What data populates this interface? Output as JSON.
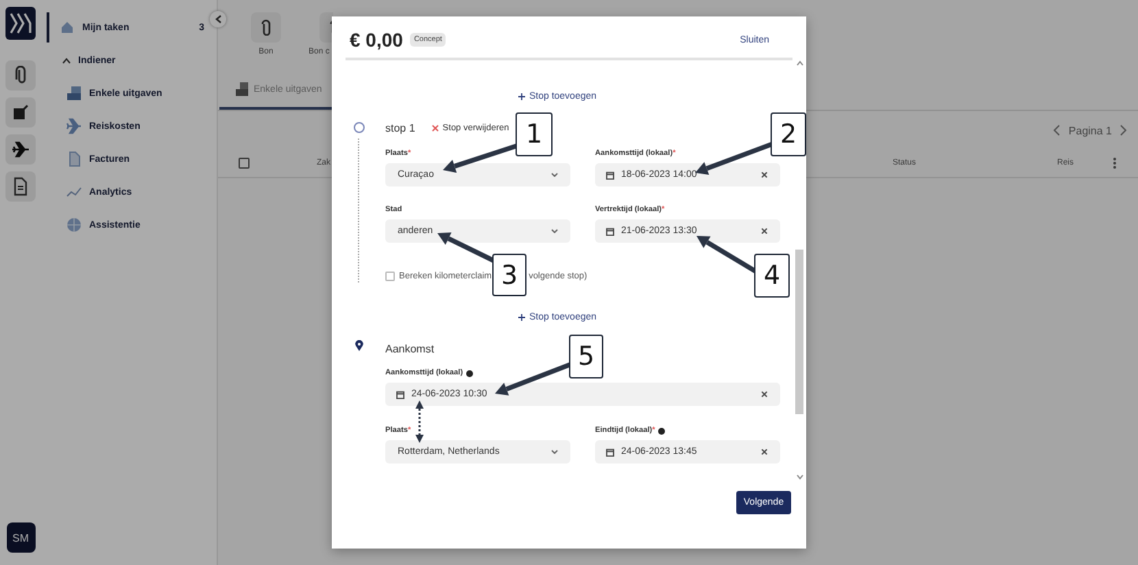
{
  "rail": {
    "items": [
      {
        "kind": "clip"
      },
      {
        "kind": "edit"
      },
      {
        "kind": "plane"
      },
      {
        "kind": "doc"
      }
    ],
    "avatar": "SM"
  },
  "sidebar": {
    "top_item": {
      "label": "Mijn taken",
      "count": "3"
    },
    "section": {
      "label": "Indiener",
      "expanded": true
    },
    "items": [
      {
        "label": "Enkele uitgaven",
        "kind": "expenses"
      },
      {
        "label": "Reiskosten",
        "kind": "travel"
      },
      {
        "label": "Facturen",
        "kind": "invoices"
      },
      {
        "label": "Analytics",
        "kind": "analytics"
      },
      {
        "label": "Assistentie",
        "kind": "assist"
      }
    ]
  },
  "toolbar": {
    "tiles": [
      {
        "label": "Bon"
      },
      {
        "label": "Bon c"
      }
    ]
  },
  "tabs": [
    {
      "label": "Enkele uitgaven",
      "selected": true
    }
  ],
  "pager": {
    "label": "Pagina 1"
  },
  "table": {
    "columns": [
      "Zak",
      "Status",
      "Reis"
    ],
    "select_all_checked": false
  },
  "modal": {
    "amount": "€ 0,00",
    "badge": "Concept",
    "close": "Sluiten",
    "add_stop": [
      "Stop toevoegen",
      "Stop toevoegen"
    ],
    "stops": [
      {
        "title": "stop 1",
        "remove": "Stop verwijderen",
        "fields": [
          {
            "label": "Plaats",
            "asterisk": "*",
            "kind": "select",
            "value": "Curaçao"
          },
          {
            "label": "Aankomsttijd (lokaal)",
            "asterisk": "*",
            "kind": "date",
            "value": "18-06-2023 14:00"
          },
          {
            "label": "Stad",
            "kind": "select",
            "value": "anderen"
          },
          {
            "label": "Vertrektijd (lokaal)",
            "asterisk": "*",
            "kind": "date",
            "value": "21-06-2023 13:30"
          }
        ],
        "mileage": {
          "checked": false,
          "label_start": "Bereken kilometerclaim",
          "label_end": "volgende stop)"
        }
      }
    ],
    "arrival": {
      "title": "Aankomst",
      "wide_field": {
        "label": "Aankomsttijd (lokaal)",
        "info": true,
        "kind": "date",
        "value": "24-06-2023 10:30"
      },
      "fields": [
        {
          "label": "Plaats",
          "asterisk": "*",
          "kind": "select",
          "value": "Rotterdam, Netherlands"
        },
        {
          "label": "Eindtijd (lokaal)",
          "asterisk": "*",
          "info": true,
          "kind": "date",
          "value": "24-06-2023 13:45"
        }
      ]
    },
    "next_button": "Volgende"
  },
  "annotations": [
    {
      "label": "1"
    },
    {
      "label": "2"
    },
    {
      "label": "3"
    },
    {
      "label": "4"
    },
    {
      "label": "5"
    }
  ]
}
